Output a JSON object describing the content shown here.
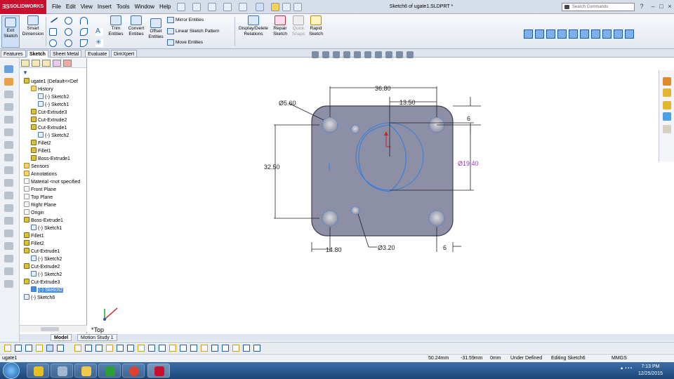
{
  "app": {
    "brand": "SOLIDWORKS",
    "doc_title": "Sketch6 of ugate1.SLDPRT *",
    "search_placeholder": "Search Commands"
  },
  "menu": [
    "File",
    "Edit",
    "View",
    "Insert",
    "Tools",
    "Window",
    "Help"
  ],
  "commandmanager": {
    "exit_sketch": "Exit\nSketch",
    "smart_dimension": "Smart\nDimension",
    "trim_entities": "Trim\nEntities",
    "convert_entities": "Convert\nEntities",
    "offset_entities": "Offset\nEntities",
    "mirror_entities": "Mirror Entities",
    "linear_sketch_pattern": "Linear Sketch Pattern",
    "move_entities": "Move Entities",
    "display_delete_relations": "Display/Delete\nRelations",
    "repair_sketch": "Repair\nSketch",
    "quick_snaps": "Quick\nSnaps",
    "rapid_sketch": "Rapid\nSketch"
  },
  "tabs": [
    "Features",
    "Sketch",
    "Sheet Metal",
    "Evaluate",
    "DimXpert"
  ],
  "active_tab": "Sketch",
  "tree": [
    {
      "label": "ugate1  (Default<<Def",
      "type": "part",
      "x": 0
    },
    {
      "label": "History",
      "type": "folder",
      "x": 10
    },
    {
      "label": "(-) Sketch2",
      "type": "sketch",
      "x": 20
    },
    {
      "label": "(-) Sketch1",
      "type": "sketch",
      "x": 20
    },
    {
      "label": "Cut-Extrude3",
      "type": "feature",
      "x": 10
    },
    {
      "label": "Cut-Extrude2",
      "type": "feature",
      "x": 10
    },
    {
      "label": "Cut-Extrude1",
      "type": "feature",
      "x": 10
    },
    {
      "label": "(-) Sketch2",
      "type": "sketch",
      "x": 20
    },
    {
      "label": "Fillet2",
      "type": "feature",
      "x": 10
    },
    {
      "label": "Fillet1",
      "type": "feature",
      "x": 10
    },
    {
      "label": "Boss-Extrude1",
      "type": "feature",
      "x": 10
    },
    {
      "label": "Sensors",
      "type": "folder",
      "x": 0
    },
    {
      "label": "Annotations",
      "type": "folder",
      "x": 0
    },
    {
      "label": "Material <not specified",
      "type": "plane",
      "x": 0
    },
    {
      "label": "Front Plane",
      "type": "plane",
      "x": 0
    },
    {
      "label": "Top Plane",
      "type": "plane",
      "x": 0
    },
    {
      "label": "Right Plane",
      "type": "plane",
      "x": 0
    },
    {
      "label": "Origin",
      "type": "plane",
      "x": 0
    },
    {
      "label": "Boss-Extrude1",
      "type": "feature",
      "x": 0
    },
    {
      "label": "(-) Sketch1",
      "type": "sketch",
      "x": 10
    },
    {
      "label": "Fillet1",
      "type": "feature",
      "x": 0
    },
    {
      "label": "Fillet2",
      "type": "feature",
      "x": 0
    },
    {
      "label": "Cut-Extrude1",
      "type": "feature",
      "x": 0
    },
    {
      "label": "(-) Sketch2",
      "type": "sketch",
      "x": 10
    },
    {
      "label": "Cut-Extrude2",
      "type": "feature",
      "x": 0
    },
    {
      "label": "(-) Sketch2",
      "type": "sketch",
      "x": 10
    },
    {
      "label": "Cut-Extrude3",
      "type": "feature",
      "x": 0
    },
    {
      "label": "(-) Sketch2",
      "type": "sketch",
      "x": 10,
      "selected": true
    },
    {
      "label": "(-) Sketch6",
      "type": "sketch",
      "x": 0
    }
  ],
  "dims": {
    "width": "36.80",
    "d1": "13.50",
    "top_off": "6",
    "hole_big": "Ø5.60",
    "height": "32.50",
    "circle": "Ø19.40",
    "hole_small": "Ø3.20",
    "left_off": "14.80",
    "right_off": "6"
  },
  "view_label": "*Top",
  "bottom_tabs": [
    "Model",
    "Motion Study 1"
  ],
  "status": {
    "part": "ugate1",
    "x": "50.24mm",
    "y": "-31.59mm",
    "z": "0mm",
    "state": "Under Defined",
    "editing": "Editing Sketch6",
    "units": "MMGS"
  },
  "clock": {
    "time": "7:13 PM",
    "date": "12/25/2015"
  },
  "colors": {
    "accent": "#1f5fb0",
    "brand": "#c8102e",
    "part_face": "#8c8fa6",
    "sketch": "#2a7de1",
    "dim_purple": "#9b30c8"
  }
}
